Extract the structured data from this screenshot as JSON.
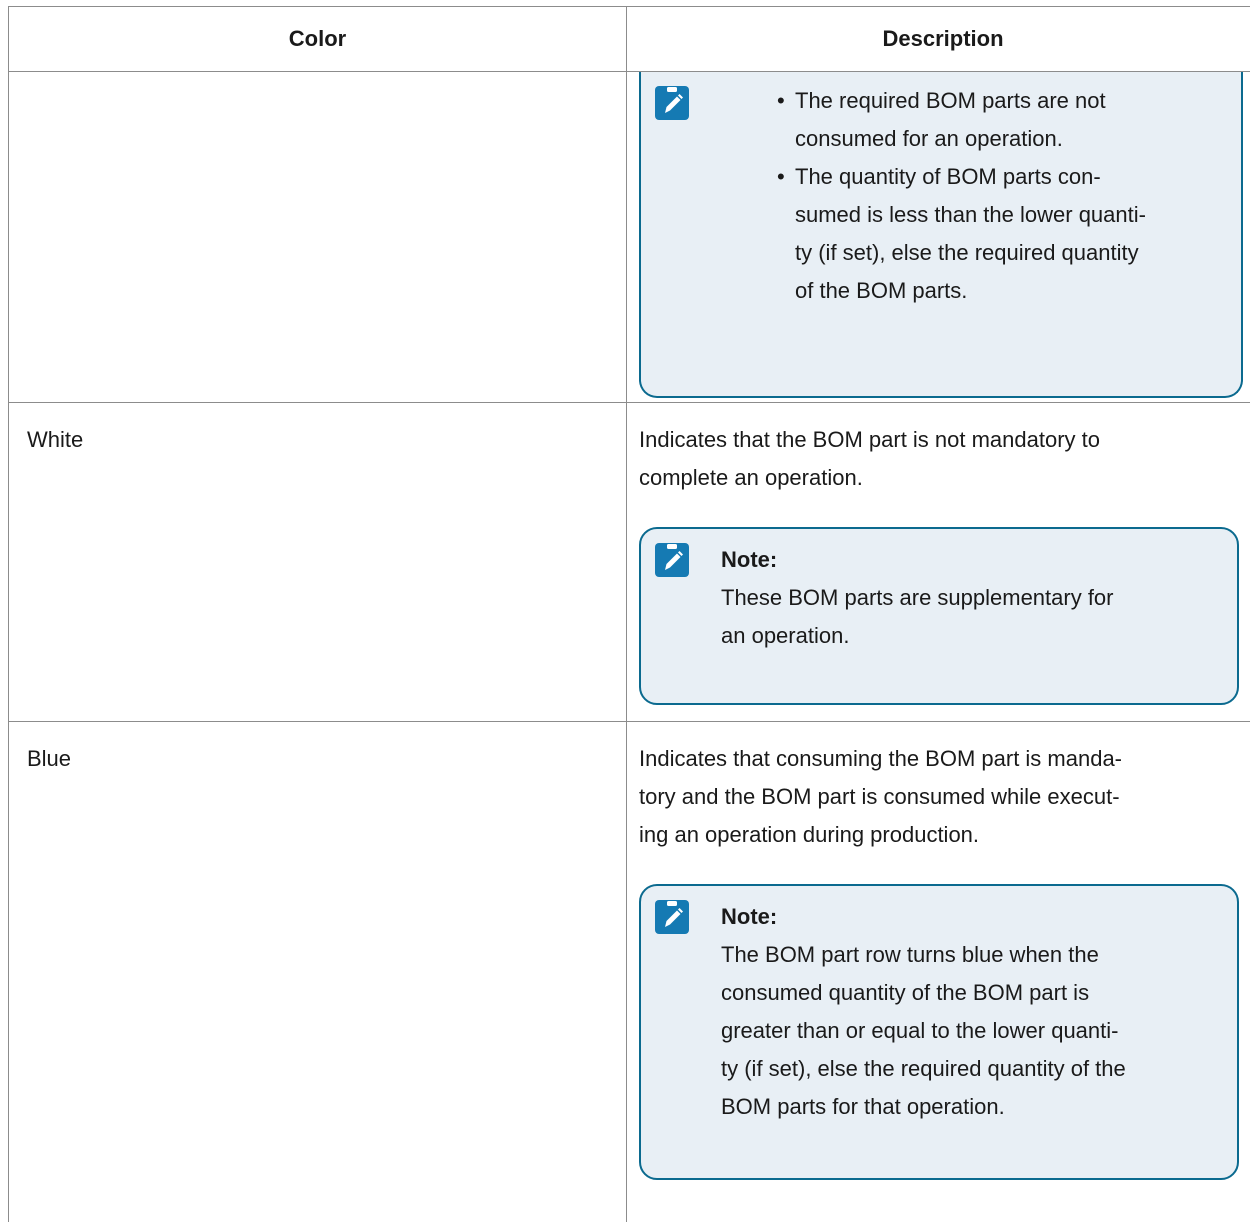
{
  "table": {
    "headers": {
      "color": "Color",
      "description": "Description"
    },
    "row1": {
      "color": "",
      "note": {
        "bullets": [
          "The required BOM parts are not consumed for an operation.",
          "The quantity of BOM parts con-sumed is less than the lower quanti-ty (if set), else the required quantity of the BOM parts."
        ],
        "bullet_lines": [
          [
            "The required BOM parts are not",
            "consumed for an operation."
          ],
          [
            "The quantity of BOM parts con-",
            "sumed is less than the lower quanti-",
            "ty (if set), else the required quantity",
            "of the BOM parts."
          ]
        ]
      }
    },
    "row2": {
      "color": "White",
      "description_lines": [
        "Indicates that the BOM part is not mandatory to",
        "complete an operation."
      ],
      "note": {
        "title": "Note:",
        "text_lines": [
          "These BOM parts are supplementary for",
          "an operation."
        ]
      }
    },
    "row3": {
      "color": "Blue",
      "description_lines": [
        "Indicates that consuming the BOM part is manda-",
        "tory and the BOM part is consumed while execut-",
        "ing an operation during production."
      ],
      "note": {
        "title": "Note:",
        "text_lines": [
          "The BOM part row turns blue when the",
          "consumed quantity of the BOM part is",
          "greater than or equal to the lower quanti-",
          "ty (if set), else the required quantity of the",
          "BOM parts for that operation."
        ]
      }
    }
  },
  "icons": {
    "note": "clipboard-pencil-icon"
  },
  "colors": {
    "note_border": "#0b6a8f",
    "note_bg": "#e8eff5",
    "icon_bg": "#157ab3"
  }
}
